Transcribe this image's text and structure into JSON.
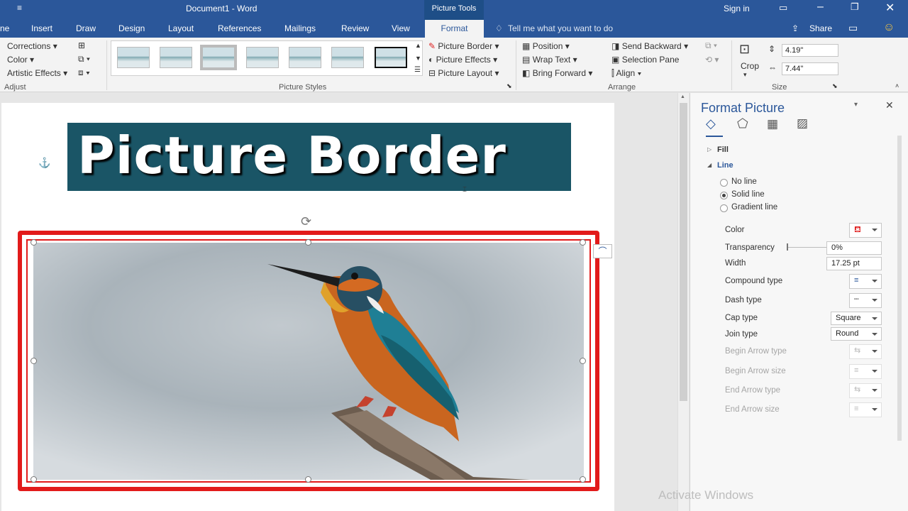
{
  "app": {
    "doc_title": "Document1  -  Word",
    "contextual_label": "Picture Tools",
    "sign_in": "Sign in",
    "share": "Share"
  },
  "tabs": [
    "ne",
    "Insert",
    "Draw",
    "Design",
    "Layout",
    "References",
    "Mailings",
    "Review",
    "View"
  ],
  "active_tab": "Format",
  "tell_me": "Tell me what you want to do",
  "ribbon": {
    "adjust": {
      "corrections": "Corrections",
      "color": "Color",
      "artistic": "Artistic Effects",
      "label": "Adjust"
    },
    "picture_styles": {
      "border": "Picture Border",
      "effects": "Picture Effects",
      "layout": "Picture Layout",
      "label": "Picture Styles"
    },
    "arrange": {
      "position": "Position",
      "wrap": "Wrap Text",
      "forward": "Bring Forward",
      "backward": "Send Backward",
      "selection": "Selection Pane",
      "align": "Align",
      "label": "Arrange"
    },
    "size": {
      "crop": "Crop",
      "height": "4.19\"",
      "width": "7.44\"",
      "label": "Size"
    }
  },
  "document": {
    "banner_text": "Picture Border"
  },
  "pane": {
    "title": "Format Picture",
    "fill": "Fill",
    "line": "Line",
    "no_line": "No line",
    "solid_line": "Solid line",
    "gradient_line": "Gradient line",
    "color": "Color",
    "transparency": "Transparency",
    "transparency_value": "0%",
    "width": "Width",
    "width_value": "17.25 pt",
    "compound": "Compound type",
    "dash": "Dash type",
    "cap": "Cap type",
    "cap_value": "Square",
    "join": "Join type",
    "join_value": "Round",
    "begin_type": "Begin Arrow type",
    "begin_size": "Begin Arrow size",
    "end_type": "End Arrow type",
    "end_size": "End Arrow size"
  },
  "watermark": "Activate Windows",
  "colors": {
    "titlebar": "#2b579a",
    "border_red": "#e21b1b",
    "banner_bg": "#1a5566"
  }
}
